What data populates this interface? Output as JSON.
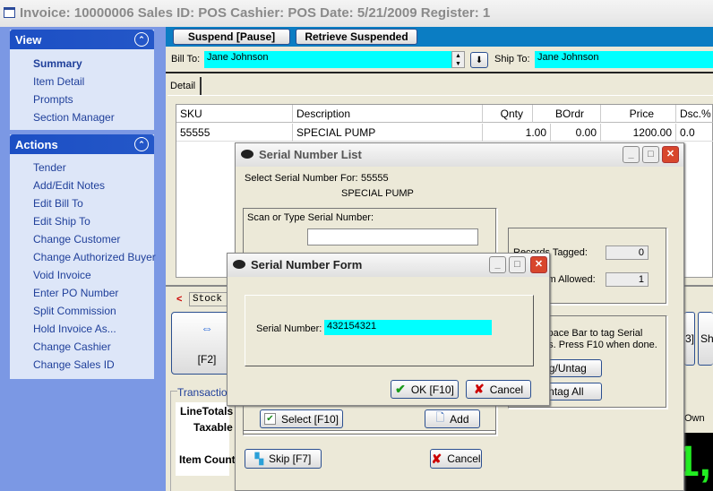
{
  "window": {
    "title": "Invoice: 10000006  Sales ID: POS  Cashier: POS   Date:  5/21/2009  Register: 1"
  },
  "sidebar": {
    "view": {
      "title": "View",
      "items": [
        "Summary",
        "Item Detail",
        "Prompts",
        "Section Manager"
      ]
    },
    "actions": {
      "title": "Actions",
      "items": [
        "Tender",
        "Add/Edit Notes",
        "Edit Bill To",
        "Edit Ship To",
        "Change Customer",
        "Change Authorized Buyer",
        "Void Invoice",
        "Enter PO Number",
        "Split Commission",
        "Hold Invoice As...",
        "Change Cashier",
        "Change Sales ID"
      ]
    }
  },
  "toolbar": {
    "suspend": "Suspend [Pause]",
    "retrieve": "Retrieve Suspended"
  },
  "customer": {
    "bill_to_label": "Bill To:",
    "bill_to": "Jane Johnson",
    "ship_to_label": "Ship To:",
    "ship_to": "Jane Johnson"
  },
  "tabs": [
    "Detail"
  ],
  "table": {
    "headers": [
      "SKU",
      "Description",
      "Qnty",
      "BOrdr",
      "Price",
      "Dsc.%"
    ],
    "rows": [
      [
        "55555",
        "SPECIAL PUMP",
        "1.00",
        "0.00",
        "1200.00",
        "0.0"
      ]
    ]
  },
  "lower": {
    "stock_label": "Stock",
    "f2": "[F2]",
    "shortcut_partial": "3]",
    "sho_partial": "Sho",
    "transaction": "Transaction",
    "line_totals": "LineTotals",
    "taxable": "Taxable",
    "item_count": "Item Count",
    "own_partial": "Own",
    "total_partial": "1,"
  },
  "serial_list": {
    "title": "Serial Number List",
    "select_for_label": "Select Serial Number For:",
    "sku": "55555",
    "description": "SPECIAL PUMP",
    "scan_label": "Scan or Type Serial Number:",
    "scan_value": "",
    "records_tagged_label": "Records Tagged:",
    "records_tagged": "0",
    "max_allowed_label": "Maximum Allowed:",
    "max_allowed": "1",
    "instructions": "Press Space Bar to tag Serial Numbers.  Press F10 when done.",
    "tag_untag": "Tag/Untag",
    "untag_all": "Untag All",
    "select": "Select [F10]",
    "add": "Add",
    "skip": "Skip [F7]",
    "cancel": "Cancel"
  },
  "serial_form": {
    "title": "Serial Number Form",
    "label": "Serial Number:",
    "value": "432154321",
    "ok": "OK [F10]",
    "cancel": "Cancel"
  },
  "colors": {
    "cyan_field": "#00ffff",
    "sidebar_header": "#1c4fc4",
    "topbar": "#0b7dc3"
  }
}
